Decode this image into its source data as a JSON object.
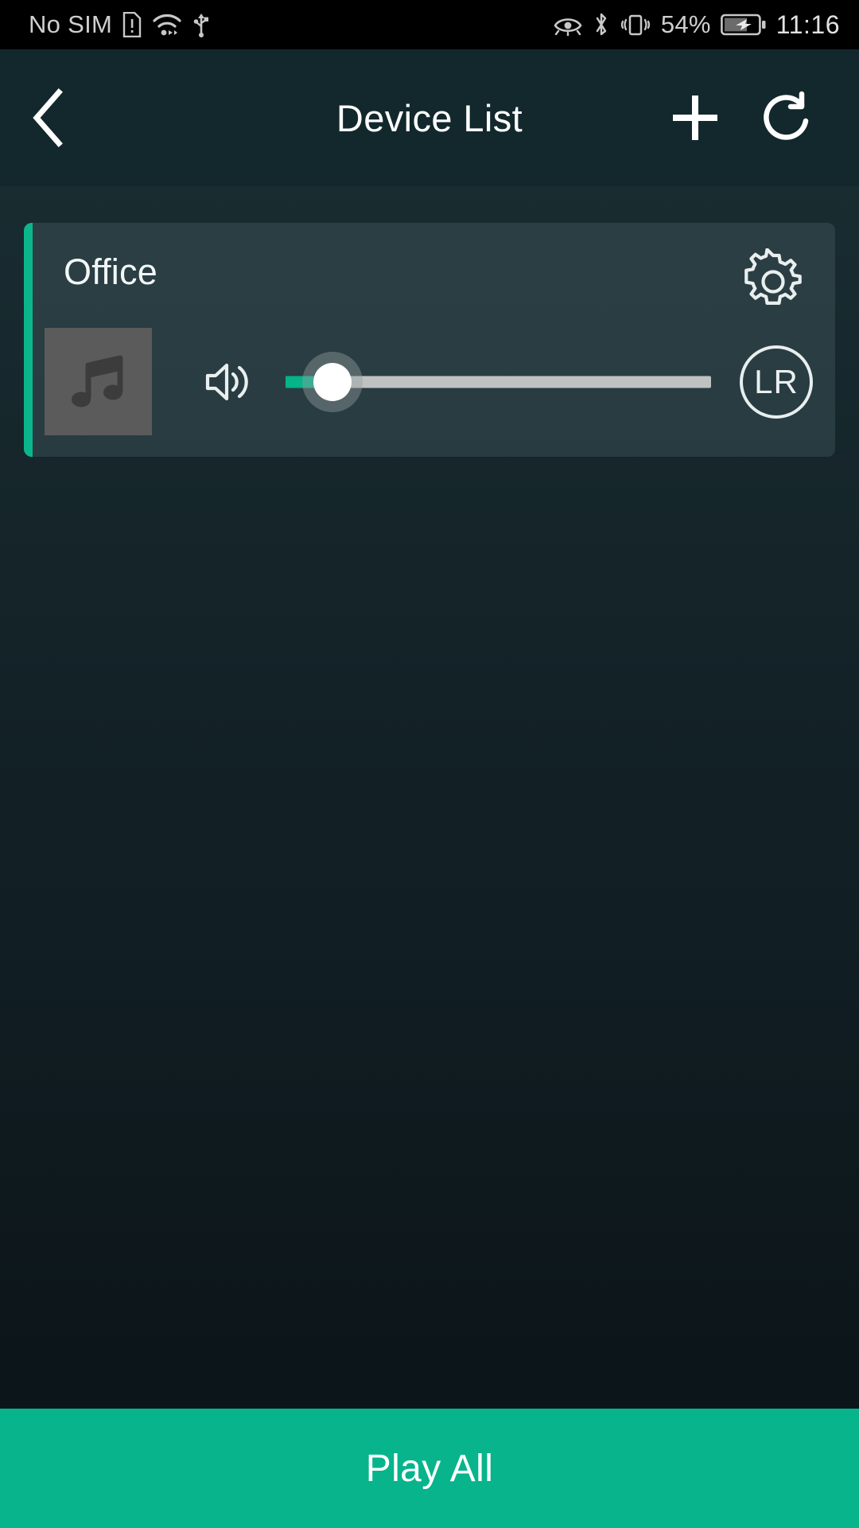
{
  "status_bar": {
    "carrier": "No SIM",
    "icons_left": [
      "sim-alert-icon",
      "wifi-icon",
      "usb-icon"
    ],
    "icons_right": [
      "eye-comfort-icon",
      "bluetooth-icon",
      "vibrate-icon"
    ],
    "battery_percent": "54%",
    "battery_state": "charging",
    "clock": "11:16"
  },
  "app_bar": {
    "title": "Device List",
    "back_icon": "chevron-left-icon",
    "add_icon": "plus-icon",
    "refresh_icon": "refresh-icon"
  },
  "devices": [
    {
      "name": "Office",
      "accent_color": "#0bb68c",
      "settings_icon": "gear-icon",
      "artwork_icon": "music-note-icon",
      "volume_icon": "speaker-icon",
      "volume_percent": 11,
      "channel_label": "LR"
    }
  ],
  "bottom_bar": {
    "play_all_label": "Play All",
    "color": "#07b48c"
  },
  "theme": {
    "background_top": "#1b3034",
    "background_bottom": "#0b1418",
    "app_bar_bg": "#12282d",
    "card_bg": "#2a3e44",
    "accent": "#0bb68c",
    "slider_track": "#c0c2c1",
    "slider_fill": "#05b488"
  }
}
